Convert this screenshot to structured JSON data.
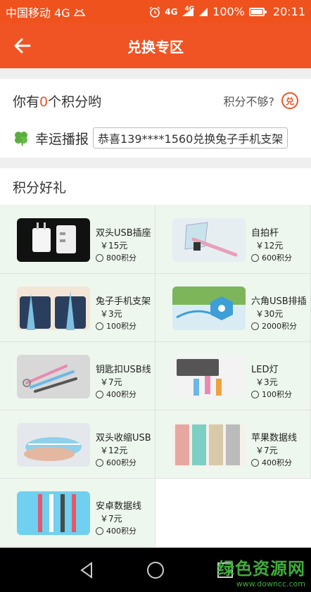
{
  "status_bar": {
    "carrier": "中国移动 4G",
    "network_1": "4G",
    "network_2": "4G",
    "battery": "100%",
    "battery_level": 1.0,
    "time": "20:11"
  },
  "header": {
    "title": "兑换专区"
  },
  "points": {
    "prefix": "你有",
    "count": "0",
    "suffix": "个积分哟",
    "not_enough": "积分不够?",
    "exchange_icon": "兑"
  },
  "lucky": {
    "label": "幸运播报",
    "message": "恭喜139****1560兑换兔子手机支架"
  },
  "gift_section": {
    "title": "积分好礼"
  },
  "products": [
    {
      "name": "双头USB插座",
      "price": "￥15元",
      "points": "800积分",
      "icon": "usb-charger-image"
    },
    {
      "name": "自拍杆",
      "price": "￥12元",
      "points": "600积分",
      "icon": "selfie-stick-image"
    },
    {
      "name": "兔子手机支架",
      "price": "￥3元",
      "points": "100积分",
      "icon": "rabbit-phone-stand-image"
    },
    {
      "name": "六角USB排插",
      "price": "￥30元",
      "points": "2000积分",
      "icon": "hex-usb-strip-image"
    },
    {
      "name": "钥匙扣USB线",
      "price": "￥7元",
      "points": "400积分",
      "icon": "keychain-usb-cable-image"
    },
    {
      "name": "LED灯",
      "price": "￥3元",
      "points": "100积分",
      "icon": "led-light-image"
    },
    {
      "name": "双头收缩USB",
      "price": "￥12元",
      "points": "600积分",
      "icon": "retractable-usb-image"
    },
    {
      "name": "苹果数据线",
      "price": "￥7元",
      "points": "400积分",
      "icon": "apple-cable-image"
    },
    {
      "name": "安卓数据线",
      "price": "￥7元",
      "points": "400积分",
      "icon": "android-cable-image"
    }
  ],
  "watermark": {
    "text": "绿色资源网",
    "url": "www.downcc.com"
  },
  "colors": {
    "accent": "#f05424",
    "cell_bg": "#eef7ee",
    "watermark": "#3fae3a"
  }
}
